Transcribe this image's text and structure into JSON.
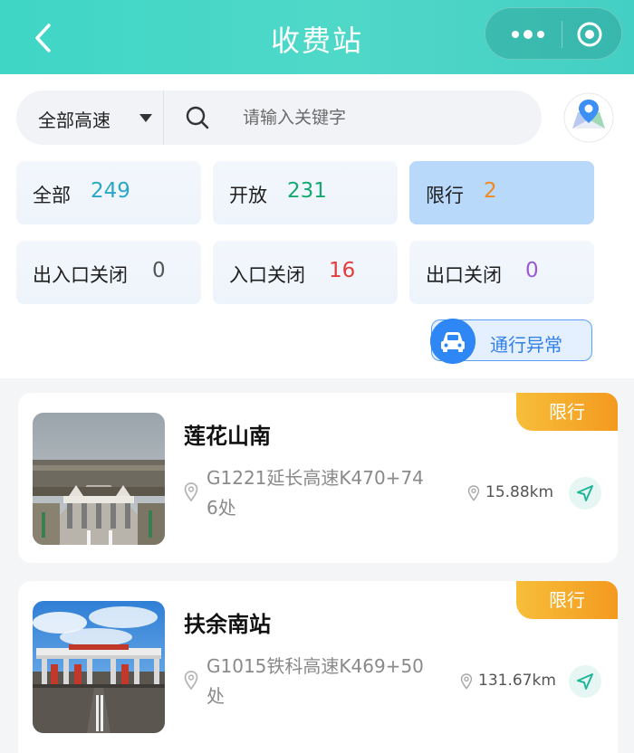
{
  "header": {
    "title": "收费站"
  },
  "search": {
    "road_filter": "全部高速",
    "placeholder": "请输入关键字"
  },
  "stats": [
    {
      "label": "全部",
      "value": "249",
      "color": "#2aa7c8"
    },
    {
      "label": "开放",
      "value": "231",
      "color": "#15a871"
    },
    {
      "label": "限行",
      "value": "2",
      "color": "#f08a1d",
      "selected": true
    },
    {
      "label": "出入口关闭",
      "value": "0",
      "color": "#555555"
    },
    {
      "label": "入口关闭",
      "value": "16",
      "color": "#e23b3b"
    },
    {
      "label": "出口关闭",
      "value": "0",
      "color": "#9a5ad2"
    }
  ],
  "abnormal_button": {
    "label": "通行异常"
  },
  "stations": [
    {
      "tag": "限行",
      "name": "莲花山南",
      "address": "G1221延长高速K470+746处",
      "address_line1": "G1221延长高速K470+74",
      "address_line2": "6处",
      "distance": "15.88km"
    },
    {
      "tag": "限行",
      "name": "扶余南站",
      "address": "G1015铁科高速K469+50处",
      "address_line1": "G1015铁科高速K469+50",
      "address_line2": "处",
      "distance": "131.67km"
    }
  ],
  "icons": {
    "back": "chevron-left-icon",
    "more": "more-dots-icon",
    "close": "target-circle-icon",
    "search": "search-icon",
    "locate": "map-location-icon",
    "car": "car-icon",
    "pin": "location-pin-icon",
    "navigate": "navigation-arrow-icon"
  },
  "colors": {
    "header": "#4fd8c8",
    "tag": "#f39a1f",
    "accent_blue": "#2f86f5"
  }
}
